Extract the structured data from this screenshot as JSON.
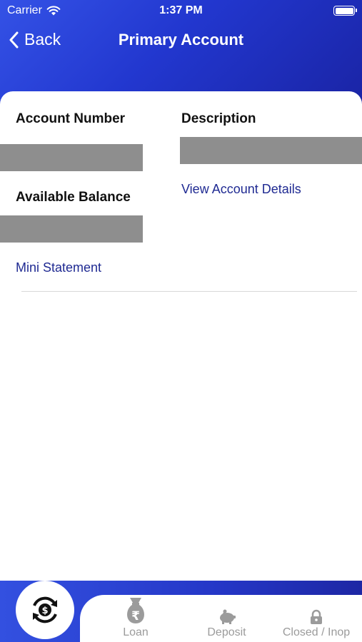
{
  "status_bar": {
    "carrier": "Carrier",
    "time": "1:37 PM"
  },
  "nav": {
    "back_label": "Back",
    "title": "Primary Account"
  },
  "account": {
    "account_number_label": "Account Number",
    "description_label": "Description",
    "available_balance_label": "Available Balance",
    "view_details_link": "View Account Details",
    "mini_statement_link": "Mini Statement"
  },
  "tabbar": {
    "tabs": [
      {
        "label": "Loan",
        "icon": "rupee-bag-icon"
      },
      {
        "label": "Deposit",
        "icon": "piggy-bank-icon"
      },
      {
        "label": "Closed / Inop",
        "icon": "lock-icon"
      }
    ],
    "home_icon": "currency-exchange-icon"
  },
  "colors": {
    "header_start": "#3452e6",
    "header_end": "#1a24a5",
    "link": "#1f2a92",
    "redaction": "#8e8e8e"
  }
}
